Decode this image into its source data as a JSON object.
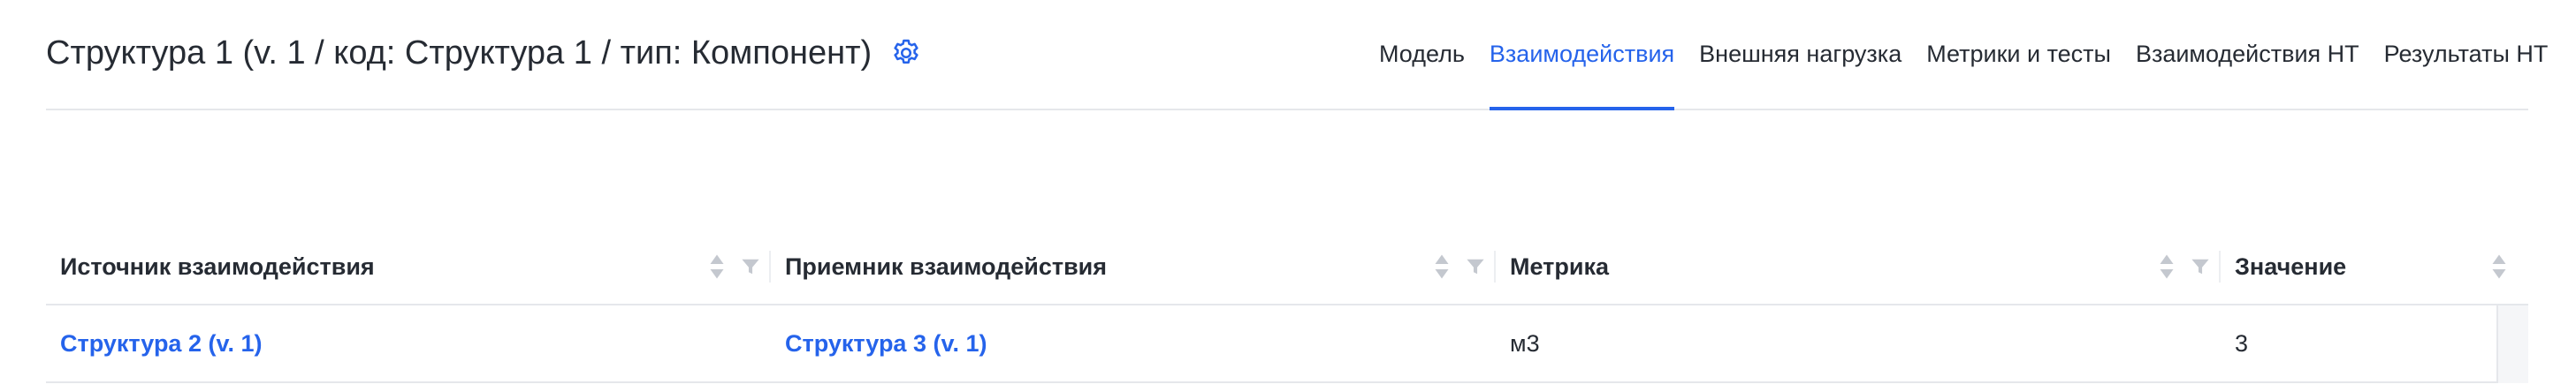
{
  "header": {
    "title": "Структура 1 (v. 1 / код: Структура 1 / тип: Компонент)",
    "settings_icon": "gear-icon",
    "tabs": [
      {
        "label": "Модель",
        "active": false
      },
      {
        "label": "Взаимодействия",
        "active": true
      },
      {
        "label": "Внешняя нагрузка",
        "active": false
      },
      {
        "label": "Метрики и тесты",
        "active": false
      },
      {
        "label": "Взаимодействия НТ",
        "active": false
      },
      {
        "label": "Результаты НТ",
        "active": false
      }
    ]
  },
  "table": {
    "columns": [
      {
        "label": "Источник взаимодействия",
        "sortable": true,
        "filterable": true
      },
      {
        "label": "Приемник взаимодействия",
        "sortable": true,
        "filterable": true
      },
      {
        "label": "Метрика",
        "sortable": true,
        "filterable": true
      },
      {
        "label": "Значение",
        "sortable": true,
        "filterable": false
      }
    ],
    "rows": [
      {
        "source": "Структура 2 (v. 1)",
        "target": "Структура 3 (v. 1)",
        "metric": "м3",
        "value": "3"
      }
    ]
  },
  "colors": {
    "accent": "#2563eb",
    "text": "#262b33",
    "border": "#e5e7eb",
    "icon_muted": "#c4c8cf"
  }
}
